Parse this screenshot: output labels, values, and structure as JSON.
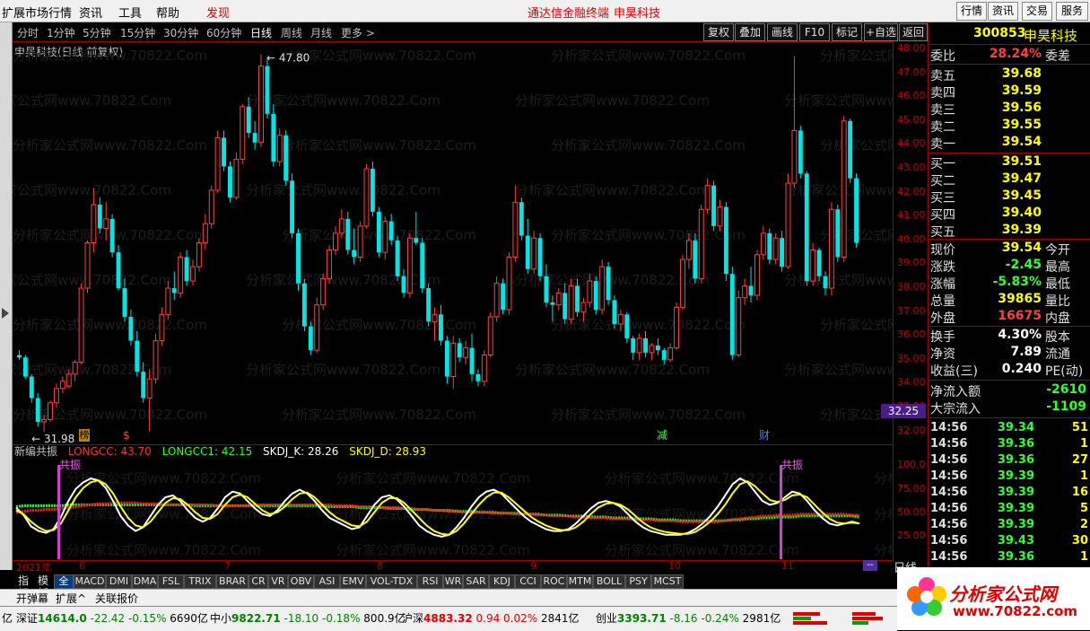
{
  "menu": {
    "items": [
      "扩展市场行情",
      "资讯",
      "工具",
      "帮助"
    ],
    "discover": "发现",
    "title_app": "通达信金融终端",
    "title_stock": "申昊科技",
    "right_buttons": [
      "行情",
      "资讯",
      "交易",
      "服务"
    ]
  },
  "periods": [
    "分时",
    "1分钟",
    "5分钟",
    "15分钟",
    "30分钟",
    "60分钟",
    "日线",
    "周线",
    "月线",
    "更多 >"
  ],
  "active_period": "日线",
  "tool_buttons": [
    "复权",
    "叠加",
    "画线",
    "F10",
    "标记",
    "+自选",
    "返回"
  ],
  "chart": {
    "title": "申昊科技(日线 前复权)",
    "high_label": "47.80",
    "low_label": "31.98",
    "current_price_tag": "32.25",
    "price_ticks": [
      "48.00",
      "47.00",
      "46.00",
      "45.00",
      "44.00",
      "43.00",
      "42.00",
      "41.00",
      "40.00",
      "39.00",
      "38.00",
      "37.00",
      "36.00",
      "35.00",
      "34.00",
      "33.00",
      "32.00"
    ],
    "markers": {
      "bang": "榜",
      "s": "$",
      "jian": "减",
      "cai": "财"
    },
    "watermark": "分析家公式网www.70822.Com"
  },
  "chart_data": {
    "type": "candlestick",
    "ylim": [
      31.5,
      48.3
    ],
    "candles": [
      [
        35.2,
        35.4,
        35.0,
        35.1
      ],
      [
        35.1,
        35.2,
        34.2,
        34.3
      ],
      [
        34.3,
        34.4,
        33.2,
        33.4
      ],
      [
        33.4,
        33.6,
        32.2,
        32.4
      ],
      [
        32.4,
        32.7,
        31.98,
        32.5
      ],
      [
        32.5,
        33.3,
        32.4,
        33.2
      ],
      [
        33.2,
        34.0,
        33.0,
        33.8
      ],
      [
        33.8,
        34.3,
        33.6,
        34.1
      ],
      [
        33.9,
        34.6,
        33.8,
        34.4
      ],
      [
        34.4,
        35.0,
        34.1,
        34.9
      ],
      [
        34.9,
        38.2,
        34.8,
        38.0
      ],
      [
        38.0,
        40.0,
        37.8,
        39.9
      ],
      [
        39.9,
        42.2,
        39.5,
        41.5
      ],
      [
        41.5,
        41.8,
        40.3,
        40.5
      ],
      [
        40.5,
        41.6,
        40.0,
        40.9
      ],
      [
        40.9,
        41.1,
        39.3,
        39.5
      ],
      [
        39.5,
        39.8,
        37.9,
        38.0
      ],
      [
        38.0,
        38.4,
        36.6,
        36.8
      ],
      [
        36.8,
        37.1,
        35.6,
        35.8
      ],
      [
        35.8,
        36.2,
        34.3,
        34.5
      ],
      [
        34.5,
        34.9,
        33.2,
        33.4
      ],
      [
        33.4,
        34.6,
        32.0,
        34.2
      ],
      [
        34.2,
        36.1,
        34.0,
        35.8
      ],
      [
        35.8,
        37.2,
        35.6,
        36.9
      ],
      [
        36.9,
        38.3,
        36.7,
        38.0
      ],
      [
        38.0,
        38.7,
        37.5,
        37.8
      ],
      [
        37.8,
        39.5,
        37.6,
        39.3
      ],
      [
        39.3,
        39.6,
        38.1,
        38.3
      ],
      [
        38.3,
        39.2,
        38.1,
        38.9
      ],
      [
        38.9,
        40.1,
        38.7,
        39.9
      ],
      [
        39.9,
        41.1,
        39.6,
        40.7
      ],
      [
        40.7,
        42.3,
        40.5,
        42.1
      ],
      [
        42.1,
        44.6,
        42.0,
        44.3
      ],
      [
        44.3,
        44.6,
        42.9,
        43.1
      ],
      [
        43.1,
        43.3,
        41.6,
        41.8
      ],
      [
        41.8,
        43.7,
        41.7,
        43.4
      ],
      [
        43.4,
        45.7,
        43.2,
        45.6
      ],
      [
        45.6,
        46.0,
        44.3,
        44.5
      ],
      [
        44.5,
        45.0,
        43.8,
        44.1
      ],
      [
        44.1,
        47.8,
        43.9,
        47.3
      ],
      [
        47.3,
        47.6,
        45.1,
        45.3
      ],
      [
        45.3,
        45.7,
        43.1,
        43.3
      ],
      [
        43.3,
        44.7,
        43.1,
        44.4
      ],
      [
        44.4,
        44.6,
        42.3,
        42.5
      ],
      [
        42.5,
        42.8,
        40.1,
        40.3
      ],
      [
        40.3,
        40.5,
        37.9,
        38.2
      ],
      [
        38.2,
        38.4,
        36.2,
        36.4
      ],
      [
        36.4,
        36.6,
        35.2,
        35.4
      ],
      [
        35.4,
        37.6,
        35.3,
        37.3
      ],
      [
        37.3,
        38.6,
        37.1,
        38.4
      ],
      [
        38.4,
        39.8,
        38.2,
        39.6
      ],
      [
        39.6,
        40.6,
        39.4,
        40.3
      ],
      [
        40.3,
        41.3,
        40.1,
        40.9
      ],
      [
        40.9,
        41.2,
        39.4,
        39.6
      ],
      [
        39.6,
        40.5,
        39.0,
        39.3
      ],
      [
        39.3,
        40.8,
        39.1,
        40.6
      ],
      [
        40.6,
        43.2,
        40.5,
        43.0
      ],
      [
        43.0,
        43.3,
        41.0,
        41.2
      ],
      [
        41.2,
        41.4,
        39.3,
        39.5
      ],
      [
        39.5,
        41.0,
        39.2,
        40.8
      ],
      [
        40.8,
        41.1,
        39.8,
        40.0
      ],
      [
        40.0,
        40.2,
        38.3,
        38.5
      ],
      [
        38.5,
        38.8,
        37.6,
        37.8
      ],
      [
        37.8,
        40.3,
        37.6,
        40.1
      ],
      [
        40.1,
        41.2,
        39.8,
        39.9
      ],
      [
        39.9,
        40.1,
        37.8,
        38.0
      ],
      [
        38.0,
        38.2,
        36.4,
        36.6
      ],
      [
        36.6,
        37.2,
        35.8,
        36.9
      ],
      [
        36.9,
        37.3,
        35.6,
        35.8
      ],
      [
        35.8,
        36.0,
        34.0,
        34.3
      ],
      [
        34.3,
        36.0,
        33.8,
        35.7
      ],
      [
        35.7,
        35.9,
        34.9,
        35.1
      ],
      [
        35.1,
        35.8,
        34.8,
        35.5
      ],
      [
        35.5,
        36.1,
        34.1,
        34.4
      ],
      [
        34.4,
        34.6,
        33.9,
        34.1
      ],
      [
        34.1,
        35.4,
        33.9,
        35.2
      ],
      [
        35.2,
        37.0,
        35.1,
        36.8
      ],
      [
        36.8,
        38.5,
        36.6,
        38.2
      ],
      [
        38.2,
        38.4,
        36.9,
        37.1
      ],
      [
        37.1,
        39.5,
        36.9,
        39.3
      ],
      [
        39.3,
        42.3,
        39.1,
        41.6
      ],
      [
        41.6,
        41.8,
        40.0,
        40.2
      ],
      [
        40.2,
        40.9,
        38.6,
        38.8
      ],
      [
        38.8,
        40.4,
        38.6,
        40.1
      ],
      [
        40.1,
        40.3,
        38.3,
        38.5
      ],
      [
        38.5,
        39.0,
        37.2,
        37.4
      ],
      [
        37.4,
        37.7,
        36.6,
        37.3
      ],
      [
        37.3,
        38.0,
        37.1,
        37.8
      ],
      [
        37.8,
        38.2,
        36.5,
        36.7
      ],
      [
        36.7,
        38.4,
        36.5,
        38.1
      ],
      [
        38.1,
        38.4,
        36.8,
        37.0
      ],
      [
        37.0,
        37.6,
        36.6,
        37.4
      ],
      [
        37.4,
        38.6,
        37.2,
        38.3
      ],
      [
        38.3,
        38.5,
        36.9,
        37.1
      ],
      [
        37.1,
        39.2,
        36.9,
        38.9
      ],
      [
        38.9,
        39.1,
        37.3,
        37.5
      ],
      [
        37.5,
        37.7,
        36.3,
        36.5
      ],
      [
        36.5,
        37.1,
        36.2,
        36.9
      ],
      [
        36.9,
        37.0,
        35.7,
        35.9
      ],
      [
        35.9,
        36.0,
        35.0,
        35.3
      ],
      [
        35.3,
        36.1,
        35.0,
        35.9
      ],
      [
        35.9,
        36.2,
        35.1,
        35.3
      ],
      [
        35.3,
        35.7,
        35.0,
        35.6
      ],
      [
        35.6,
        35.9,
        35.2,
        35.4
      ],
      [
        35.4,
        35.5,
        34.8,
        35.0
      ],
      [
        35.0,
        35.7,
        34.9,
        35.5
      ],
      [
        35.5,
        37.4,
        35.4,
        37.2
      ],
      [
        37.2,
        39.4,
        37.1,
        39.2
      ],
      [
        39.2,
        40.3,
        38.8,
        40.0
      ],
      [
        40.0,
        40.3,
        38.2,
        38.4
      ],
      [
        38.4,
        41.5,
        38.2,
        41.3
      ],
      [
        41.3,
        42.6,
        41.1,
        42.3
      ],
      [
        42.3,
        42.5,
        40.4,
        40.6
      ],
      [
        40.6,
        41.7,
        40.4,
        41.4
      ],
      [
        41.4,
        41.6,
        38.3,
        38.6
      ],
      [
        38.6,
        38.9,
        35.0,
        35.2
      ],
      [
        35.2,
        37.9,
        35.1,
        37.6
      ],
      [
        37.6,
        38.4,
        37.3,
        38.1
      ],
      [
        38.1,
        38.9,
        37.4,
        37.7
      ],
      [
        37.7,
        39.6,
        37.5,
        39.4
      ],
      [
        39.4,
        40.6,
        39.2,
        40.3
      ],
      [
        40.3,
        40.5,
        39.0,
        39.2
      ],
      [
        39.2,
        40.3,
        39.0,
        40.1
      ],
      [
        40.1,
        40.4,
        38.7,
        38.9
      ],
      [
        38.9,
        42.8,
        38.8,
        42.4
      ],
      [
        42.4,
        47.7,
        42.2,
        44.6
      ],
      [
        44.6,
        44.8,
        42.6,
        42.8
      ],
      [
        42.8,
        42.9,
        38.1,
        38.3
      ],
      [
        38.3,
        39.9,
        38.1,
        39.6
      ],
      [
        39.6,
        39.7,
        38.3,
        38.5
      ],
      [
        38.5,
        38.7,
        37.7,
        38.0
      ],
      [
        38.0,
        41.6,
        37.7,
        41.3
      ],
      [
        41.3,
        41.5,
        39.1,
        39.3
      ],
      [
        39.3,
        45.2,
        39.1,
        45.0
      ],
      [
        45.0,
        45.1,
        42.4,
        42.6
      ],
      [
        42.6,
        42.8,
        39.7,
        39.9
      ]
    ]
  },
  "indicator": {
    "name": "新编共振",
    "longcc_label": "LONGCC: 43.70",
    "longcc1_label": "LONGCC1: 42.15",
    "skdj_k_label": "SKDJ_K: 28.26",
    "skdj_d_label": "SKDJ_D: 28.93",
    "resonance_label": "共振",
    "ticks": [
      "100.0",
      "75.00",
      "50.00",
      "25.00"
    ],
    "ylim": [
      0,
      110
    ],
    "k_values": [
      55,
      47,
      35,
      30,
      28,
      32,
      45,
      62,
      75,
      82,
      86,
      84,
      76,
      62,
      46,
      36,
      30,
      34,
      46,
      58,
      66,
      68,
      62,
      52,
      44,
      40,
      44,
      54,
      66,
      72,
      70,
      62,
      54,
      48,
      46,
      52,
      62,
      70,
      74,
      70,
      62,
      52,
      44,
      40,
      36,
      32,
      34,
      46,
      58,
      66,
      68,
      64,
      56,
      46,
      36,
      30,
      26,
      24,
      26,
      34,
      44,
      56,
      66,
      72,
      74,
      70,
      62,
      54,
      46,
      40,
      36,
      32,
      30,
      30,
      32,
      38,
      46,
      54,
      60,
      62,
      60,
      56,
      48,
      40,
      34,
      30,
      28,
      26,
      26,
      26,
      28,
      32,
      38,
      46,
      56,
      68,
      80,
      86,
      82,
      72,
      62,
      58,
      60,
      66,
      72,
      70,
      62,
      52,
      44,
      38,
      36,
      38,
      40,
      38
    ],
    "d_values": [
      52,
      48,
      40,
      34,
      30,
      31,
      38,
      52,
      66,
      76,
      82,
      84,
      80,
      70,
      56,
      44,
      36,
      34,
      40,
      50,
      60,
      65,
      64,
      58,
      50,
      44,
      43,
      48,
      58,
      66,
      69,
      66,
      59,
      52,
      48,
      50,
      56,
      64,
      70,
      71,
      66,
      58,
      50,
      44,
      40,
      36,
      35,
      40,
      50,
      60,
      65,
      65,
      60,
      52,
      44,
      36,
      30,
      27,
      26,
      30,
      38,
      48,
      58,
      66,
      71,
      71,
      66,
      59,
      52,
      45,
      40,
      36,
      33,
      31,
      31,
      34,
      40,
      48,
      55,
      59,
      60,
      58,
      53,
      46,
      39,
      34,
      31,
      29,
      28,
      27,
      27,
      29,
      34,
      40,
      48,
      58,
      70,
      80,
      83,
      78,
      70,
      63,
      61,
      63,
      68,
      69,
      66,
      58,
      50,
      43,
      39,
      38,
      39,
      38
    ],
    "longcc_values": [
      50,
      51,
      52,
      52,
      53,
      53,
      54,
      55,
      56,
      57,
      58,
      59,
      59,
      60,
      60,
      60,
      60,
      59,
      59,
      59,
      58,
      58,
      58,
      58,
      58,
      58,
      58,
      57,
      57,
      57,
      57,
      57,
      58,
      58,
      58,
      58,
      58,
      58,
      58,
      58,
      58,
      58,
      58,
      57,
      57,
      57,
      56,
      56,
      56,
      55,
      55,
      55,
      54,
      54,
      53,
      53,
      52,
      52,
      51,
      51,
      50,
      50,
      50,
      50,
      49,
      49,
      49,
      48,
      48,
      48,
      47,
      47,
      46,
      46,
      46,
      45,
      45,
      44,
      44,
      44,
      43,
      43,
      43,
      42,
      42,
      42,
      41,
      41,
      41,
      40,
      40,
      40,
      40,
      40,
      40,
      41,
      42,
      43,
      44,
      45,
      46,
      46,
      47,
      47,
      47,
      48,
      48,
      48,
      48,
      48,
      48,
      48,
      47,
      47
    ],
    "longcc1_values": [
      56,
      57,
      57,
      57,
      57,
      57,
      57,
      58,
      58,
      58,
      58,
      58,
      58,
      58,
      58,
      58,
      58,
      58,
      58,
      58,
      58,
      58,
      58,
      58,
      57,
      57,
      57,
      57,
      57,
      57,
      57,
      57,
      57,
      57,
      57,
      57,
      57,
      57,
      57,
      57,
      57,
      57,
      56,
      56,
      56,
      56,
      55,
      55,
      55,
      55,
      54,
      54,
      54,
      53,
      53,
      53,
      52,
      52,
      52,
      51,
      51,
      51,
      50,
      50,
      50,
      49,
      49,
      49,
      48,
      48,
      48,
      47,
      47,
      47,
      46,
      46,
      46,
      45,
      45,
      45,
      44,
      44,
      44,
      43,
      43,
      43,
      42,
      42,
      42,
      41,
      41,
      41,
      41,
      41,
      41,
      41,
      42,
      42,
      43,
      43,
      44,
      44,
      45,
      45,
      45,
      46,
      46,
      46,
      46,
      46,
      46,
      46,
      46,
      45
    ]
  },
  "date_labels": [
    "2021年",
    "6",
    "7",
    "8",
    "9",
    "10",
    "11"
  ],
  "tabs": [
    "指标",
    "模板",
    "全部",
    "MACD",
    "DMI",
    "DMA",
    "FSL",
    "TRIX",
    "BRAR",
    "CR",
    "VR",
    "OBV",
    "ASI",
    "EMV",
    "VOL-TDX",
    "RSI",
    "WR",
    "SAR",
    "KDJ",
    "CCI",
    "ROC",
    "MTM",
    "BOLL",
    "PSY",
    "MCST"
  ],
  "tab_selected": "全部",
  "bottom_buttons": [
    "开弹幕",
    "扩展^",
    "关联报价"
  ],
  "rline_label": "日线",
  "status": [
    {
      "name": "深证",
      "value": "14614.0",
      "chg": "-22.42",
      "pct": "-0.15%",
      "amt": "6690亿"
    },
    {
      "name": "中小",
      "value": "9822.71",
      "chg": "-18.10",
      "pct": "-0.18%",
      "amt": "800.9亿"
    },
    {
      "name": "沪深",
      "value": "4883.32",
      "chg": "0.94",
      "pct": "0.02%",
      "amt": "2841亿"
    },
    {
      "name": "创业",
      "value": "3393.71",
      "chg": "-8.16",
      "pct": "-0.24%",
      "amt": "2981亿"
    }
  ],
  "status_prefix": "亿",
  "quote": {
    "code": "300853",
    "name": "申昊科技",
    "ratio_label": "委比",
    "ratio_value": "28.24%",
    "diff_label": "委差",
    "asks": [
      {
        "l": "卖五",
        "v": "39.68"
      },
      {
        "l": "卖四",
        "v": "39.59"
      },
      {
        "l": "卖三",
        "v": "39.56"
      },
      {
        "l": "卖二",
        "v": "39.55"
      },
      {
        "l": "卖一",
        "v": "39.54"
      }
    ],
    "bids": [
      {
        "l": "买一",
        "v": "39.51"
      },
      {
        "l": "买二",
        "v": "39.47"
      },
      {
        "l": "买三",
        "v": "39.45"
      },
      {
        "l": "买四",
        "v": "39.40"
      },
      {
        "l": "买五",
        "v": "39.39"
      }
    ],
    "stats": [
      {
        "l": "现价",
        "v": "39.54",
        "l2": "今开"
      },
      {
        "l": "涨跌",
        "v": "-2.45",
        "l2": "最高"
      },
      {
        "l": "涨幅",
        "v": "-5.83%",
        "l2": "最低"
      },
      {
        "l": "总量",
        "v": "39865",
        "l2": "量比"
      },
      {
        "l": "外盘",
        "v": "16675",
        "l2": "内盘"
      }
    ],
    "stats2": [
      {
        "l": "换手",
        "v": "4.30%",
        "l2": "股本"
      },
      {
        "l": "净资",
        "v": "7.89",
        "l2": "流通"
      },
      {
        "l": "收益(三)",
        "v": "0.240",
        "l2": "PE(动)"
      }
    ],
    "flow": [
      {
        "l": "净流入额",
        "v": "-2610"
      },
      {
        "l": "大宗流入",
        "v": "-1109"
      }
    ],
    "ticks": [
      {
        "t": "14:56",
        "p": "39.34",
        "v": "51"
      },
      {
        "t": "14:56",
        "p": "39.36",
        "v": "1"
      },
      {
        "t": "14:56",
        "p": "39.36",
        "v": "27"
      },
      {
        "t": "14:56",
        "p": "39.39",
        "v": "1"
      },
      {
        "t": "14:56",
        "p": "39.39",
        "v": "16"
      },
      {
        "t": "14:56",
        "p": "39.39",
        "v": "5"
      },
      {
        "t": "14:56",
        "p": "39.39",
        "v": "2"
      },
      {
        "t": "14:56",
        "p": "39.43",
        "v": "30"
      },
      {
        "t": "14:56",
        "p": "39.36",
        "v": "1"
      }
    ]
  },
  "logo": {
    "text": "分析家公式网",
    "url": "www.70822.com"
  },
  "colors": {
    "up": "#ff4040",
    "down": "#00e5e5",
    "k_line": "#ffffff",
    "d_line": "#ffff00",
    "longcc": "#ff2020",
    "longcc1": "#20ff20"
  }
}
